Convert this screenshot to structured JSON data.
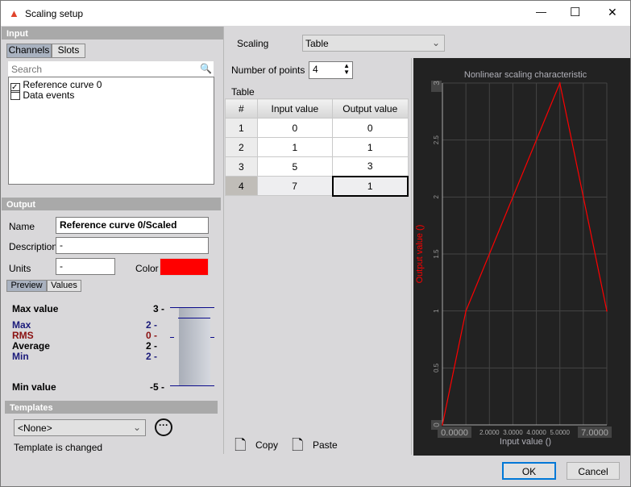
{
  "window": {
    "title": "Scaling setup",
    "minimize": "—",
    "maximize": "☐",
    "close": "✕"
  },
  "input": {
    "header": "Input",
    "tabs": [
      "Channels",
      "Slots"
    ],
    "search_placeholder": "Search",
    "channels": [
      {
        "label": "Reference curve 0",
        "checked": true
      },
      {
        "label": "Data events",
        "checked": false
      }
    ]
  },
  "output": {
    "header": "Output",
    "name_label": "Name",
    "name_value": "Reference curve 0/Scaled",
    "description_label": "Description",
    "description_value": "-",
    "units_label": "Units",
    "units_value": "-",
    "color_label": "Color",
    "color": "#ff0000",
    "tabs": [
      "Preview",
      "Values"
    ],
    "stats": {
      "max_value_label": "Max value",
      "max_value": "3 -",
      "max_label": "Max",
      "max": "2 -",
      "rms_label": "RMS",
      "rms": "0 -",
      "average_label": "Average",
      "average": "2 -",
      "min_label": "Min",
      "min": "2 -",
      "min_value_label": "Min value",
      "min_value": "-5 -"
    }
  },
  "templates": {
    "header": "Templates",
    "selected": "<None>",
    "status": "Template is changed"
  },
  "scaling": {
    "label": "Scaling",
    "value": "Table",
    "points_label": "Number of points",
    "points": "4",
    "table_label": "Table",
    "columns": [
      "#",
      "Input value",
      "Output value"
    ],
    "rows": [
      [
        "1",
        "0",
        "0"
      ],
      [
        "2",
        "1",
        "1"
      ],
      [
        "3",
        "5",
        "3"
      ],
      [
        "4",
        "7",
        "1"
      ]
    ],
    "copy": "Copy",
    "paste": "Paste"
  },
  "chart_data": {
    "type": "line",
    "title": "Nonlinear scaling characteristic",
    "xlabel": "Input value ()",
    "ylabel": "Output value ()",
    "x": [
      0,
      1,
      5,
      7
    ],
    "y": [
      0,
      1,
      3,
      1
    ],
    "xlim": [
      0,
      7
    ],
    "ylim": [
      0,
      3
    ],
    "xticks": [
      "0.0000",
      "2.0000",
      "3.0000",
      "4.0000",
      "5.0000",
      "7.0000"
    ],
    "xtick_values": [
      0,
      2,
      3,
      4,
      5,
      7
    ],
    "yticks": [
      "0",
      "0.5",
      "1",
      "1.5",
      "2",
      "2.5",
      "3"
    ],
    "ytick_values": [
      0,
      0.5,
      1,
      1.5,
      2,
      2.5,
      3
    ],
    "grid": true,
    "line_color": "#ff0000",
    "background": "#222222"
  },
  "footer": {
    "ok": "OK",
    "cancel": "Cancel"
  }
}
